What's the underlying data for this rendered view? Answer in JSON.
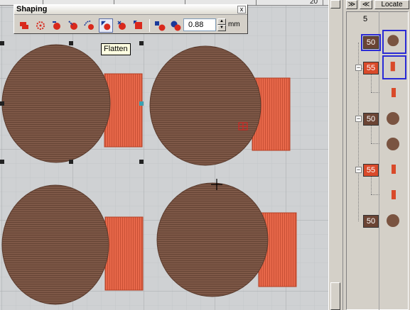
{
  "ruler": {
    "label": "20"
  },
  "shaping": {
    "title": "Shaping",
    "close_glyph": "x",
    "thickness_value": "0.88",
    "thickness_unit": "mm"
  },
  "tooltip": {
    "text": "Flatten"
  },
  "right_panel": {
    "collapse_label": "≫",
    "expand_label": "≪",
    "locate_label": "Locate",
    "count": "5",
    "items": [
      {
        "seq": "50",
        "kind": "circle",
        "color": "#7a5441",
        "selected": true
      },
      {
        "seq": "55",
        "kind": "rect",
        "color": "#d94a2a",
        "selected": true
      },
      {
        "seq": "",
        "kind": "rect",
        "color": "#d94a2a",
        "selected": false
      },
      {
        "seq": "50",
        "kind": "circle",
        "color": "#7a5441",
        "selected": false
      },
      {
        "seq": "",
        "kind": "circle",
        "color": "#7a5441",
        "selected": false
      },
      {
        "seq": "55",
        "kind": "rect",
        "color": "#d94a2a",
        "selected": false
      },
      {
        "seq": "",
        "kind": "rect",
        "color": "#d94a2a",
        "selected": false
      },
      {
        "seq": "50",
        "kind": "circle",
        "color": "#7a5441",
        "selected": false
      }
    ]
  },
  "colors": {
    "brown": "#7a5441",
    "orange": "#e8684a",
    "grid_bg": "#cfd1d3",
    "grid_line": "#b9bcc0"
  }
}
